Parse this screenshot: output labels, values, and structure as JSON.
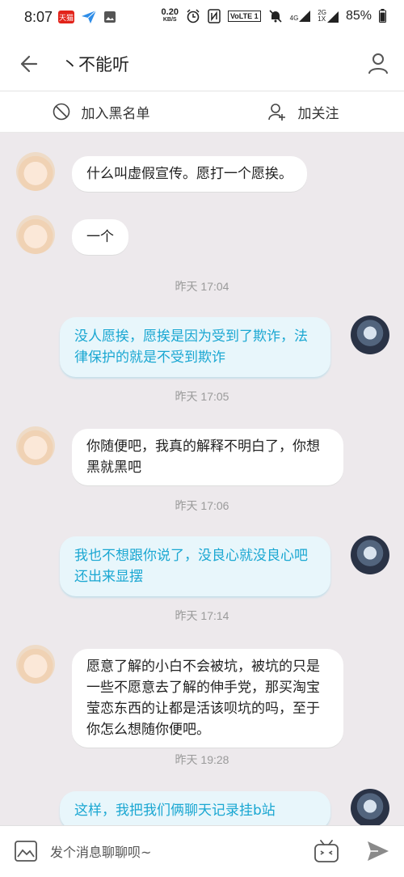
{
  "status_bar": {
    "time": "8:07",
    "net_speed_value": "0.20",
    "net_speed_unit": "KB/S",
    "volte": "VoLTE 1",
    "net_4g": "4G",
    "net_2g": "2G",
    "net_1x": "1X",
    "battery": "85%",
    "tmall_badge": "天猫"
  },
  "header": {
    "title": "丶不能听"
  },
  "actions": {
    "blacklist_label": "加入黑名单",
    "follow_label": "加关注"
  },
  "messages": [
    {
      "side": "left",
      "text": "什么叫虚假宣传。愿打一个愿挨。"
    },
    {
      "side": "left",
      "text": "一个"
    },
    {
      "side": "right",
      "text": "没人愿挨，愿挨是因为受到了欺诈，法律保护的就是不受到欺诈"
    },
    {
      "side": "left",
      "text": "你随便吧，我真的解释不明白了，你想黑就黑吧"
    },
    {
      "side": "right",
      "text": "我也不想跟你说了，没良心就没良心吧还出来显摆"
    },
    {
      "side": "left",
      "text": "愿意了解的小白不会被坑，被坑的只是一些不愿意去了解的伸手党，那买淘宝莹恋东西的让都是活该呗坑的吗，至于你怎么想随你便吧。"
    },
    {
      "side": "right",
      "text": "这样，我把我们俩聊天记录挂b站"
    }
  ],
  "timestamps": [
    "昨天 17:04",
    "昨天 17:05",
    "昨天 17:06",
    "昨天 17:14",
    "昨天 19:28"
  ],
  "input": {
    "placeholder": "发个消息聊聊呗~"
  },
  "colors": {
    "accent": "#1aa7d2",
    "outgoing_bubble": "#e8f6fb",
    "background": "#ede9ec"
  }
}
